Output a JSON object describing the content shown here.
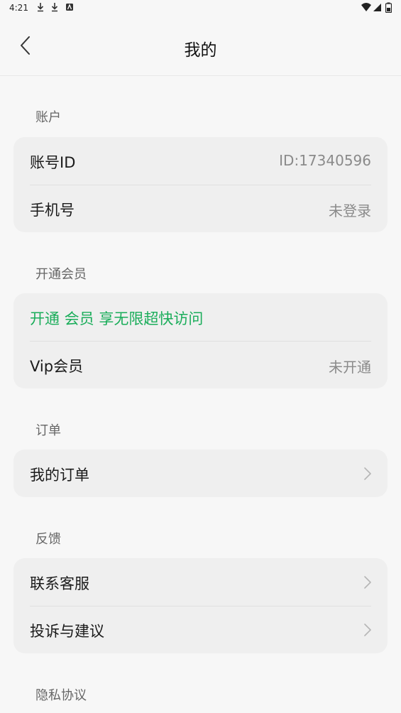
{
  "status": {
    "time": "4:21"
  },
  "header": {
    "title": "我的"
  },
  "sections": {
    "account": {
      "label": "账户",
      "rows": [
        {
          "label": "账号ID",
          "value": "ID:17340596"
        },
        {
          "label": "手机号",
          "value": "未登录"
        }
      ]
    },
    "vip": {
      "label": "开通会员",
      "rows": [
        {
          "label": "开通 会员 享无限超快访问",
          "value": ""
        },
        {
          "label": "Vip会员",
          "value": "未开通"
        }
      ]
    },
    "orders": {
      "label": "订单",
      "rows": [
        {
          "label": "我的订单"
        }
      ]
    },
    "feedback": {
      "label": "反馈",
      "rows": [
        {
          "label": "联系客服"
        },
        {
          "label": "投诉与建议"
        }
      ]
    },
    "privacy": {
      "label": "隐私协议"
    }
  },
  "colors": {
    "accent_green": "#1aad5a",
    "background": "#f7f7f7",
    "card": "#efefef"
  },
  "icons": [
    "download-icon",
    "download-icon",
    "app-notification-icon",
    "wifi-icon",
    "signal-icon",
    "battery-icon",
    "back-arrow-icon",
    "chevron-right-icon"
  ]
}
